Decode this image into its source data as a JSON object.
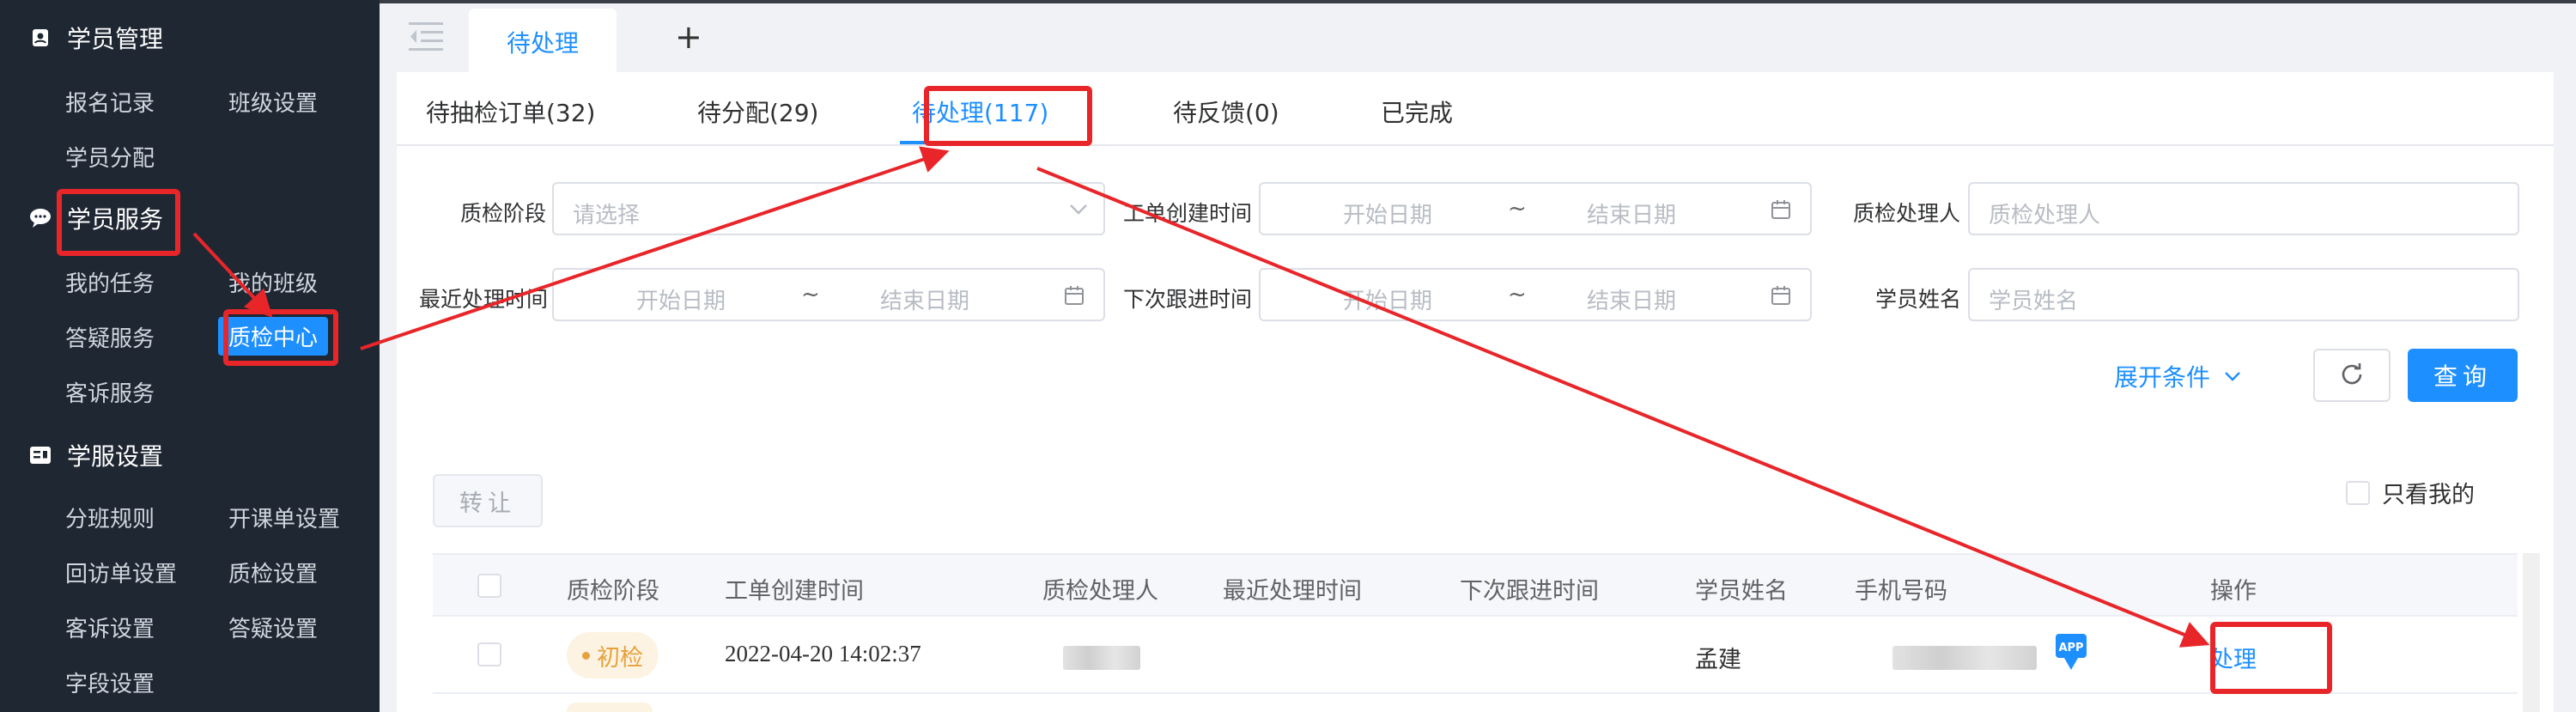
{
  "sidebar": {
    "sections": [
      {
        "title": "学员管理",
        "icon": "contacts-icon"
      },
      {
        "title": "学员服务",
        "icon": "chat-bubble-icon"
      },
      {
        "title": "学服设置",
        "icon": "settings-card-icon"
      }
    ],
    "items": {
      "signup_records": "报名记录",
      "class_settings": "班级设置",
      "student_assign": "学员分配",
      "my_tasks": "我的任务",
      "my_classes": "我的班级",
      "qa_service": "答疑服务",
      "qc_center": "质检中心",
      "complaint_service": "客诉服务",
      "class_rules": "分班规则",
      "open_order_settings": "开课单设置",
      "callback_settings": "回访单设置",
      "qc_settings": "质检设置",
      "complaint_settings": "客诉设置",
      "qa_settings": "答疑设置",
      "field_settings": "字段设置"
    }
  },
  "topbar": {
    "active_tab": "待处理",
    "add_tab": "+"
  },
  "subtabs": [
    "待抽检订单(32)",
    "待分配(29)",
    "待处理(117)",
    "待反馈(0)",
    "已完成"
  ],
  "filters": {
    "qc_stage": {
      "label": "质检阶段",
      "placeholder": "请选择"
    },
    "order_created": {
      "label": "工单创建时间",
      "start": "开始日期",
      "end": "结束日期",
      "sep": "~"
    },
    "qc_handler": {
      "label": "质检处理人",
      "placeholder": "质检处理人"
    },
    "last_processed": {
      "label": "最近处理时间",
      "start": "开始日期",
      "end": "结束日期",
      "sep": "~"
    },
    "next_followup": {
      "label": "下次跟进时间",
      "start": "开始日期",
      "end": "结束日期",
      "sep": "~"
    },
    "student_name": {
      "label": "学员姓名",
      "placeholder": "学员姓名"
    }
  },
  "actions": {
    "expand": "展开条件",
    "query": "查询",
    "transfer": "转让",
    "only_mine": "只看我的"
  },
  "table": {
    "headers": [
      "质检阶段",
      "工单创建时间",
      "质检处理人",
      "最近处理时间",
      "下次跟进时间",
      "学员姓名",
      "手机号码",
      "操作"
    ],
    "rows": [
      {
        "stage": "初检",
        "created": "2022-04-20 14:02:37",
        "student": "孟建",
        "action": "处理"
      }
    ]
  },
  "colors": {
    "accent": "#1e8fff",
    "sidebar_bg": "#1f2733",
    "annotation_red": "#e8262a",
    "tag_orange": "#e6a23c"
  }
}
